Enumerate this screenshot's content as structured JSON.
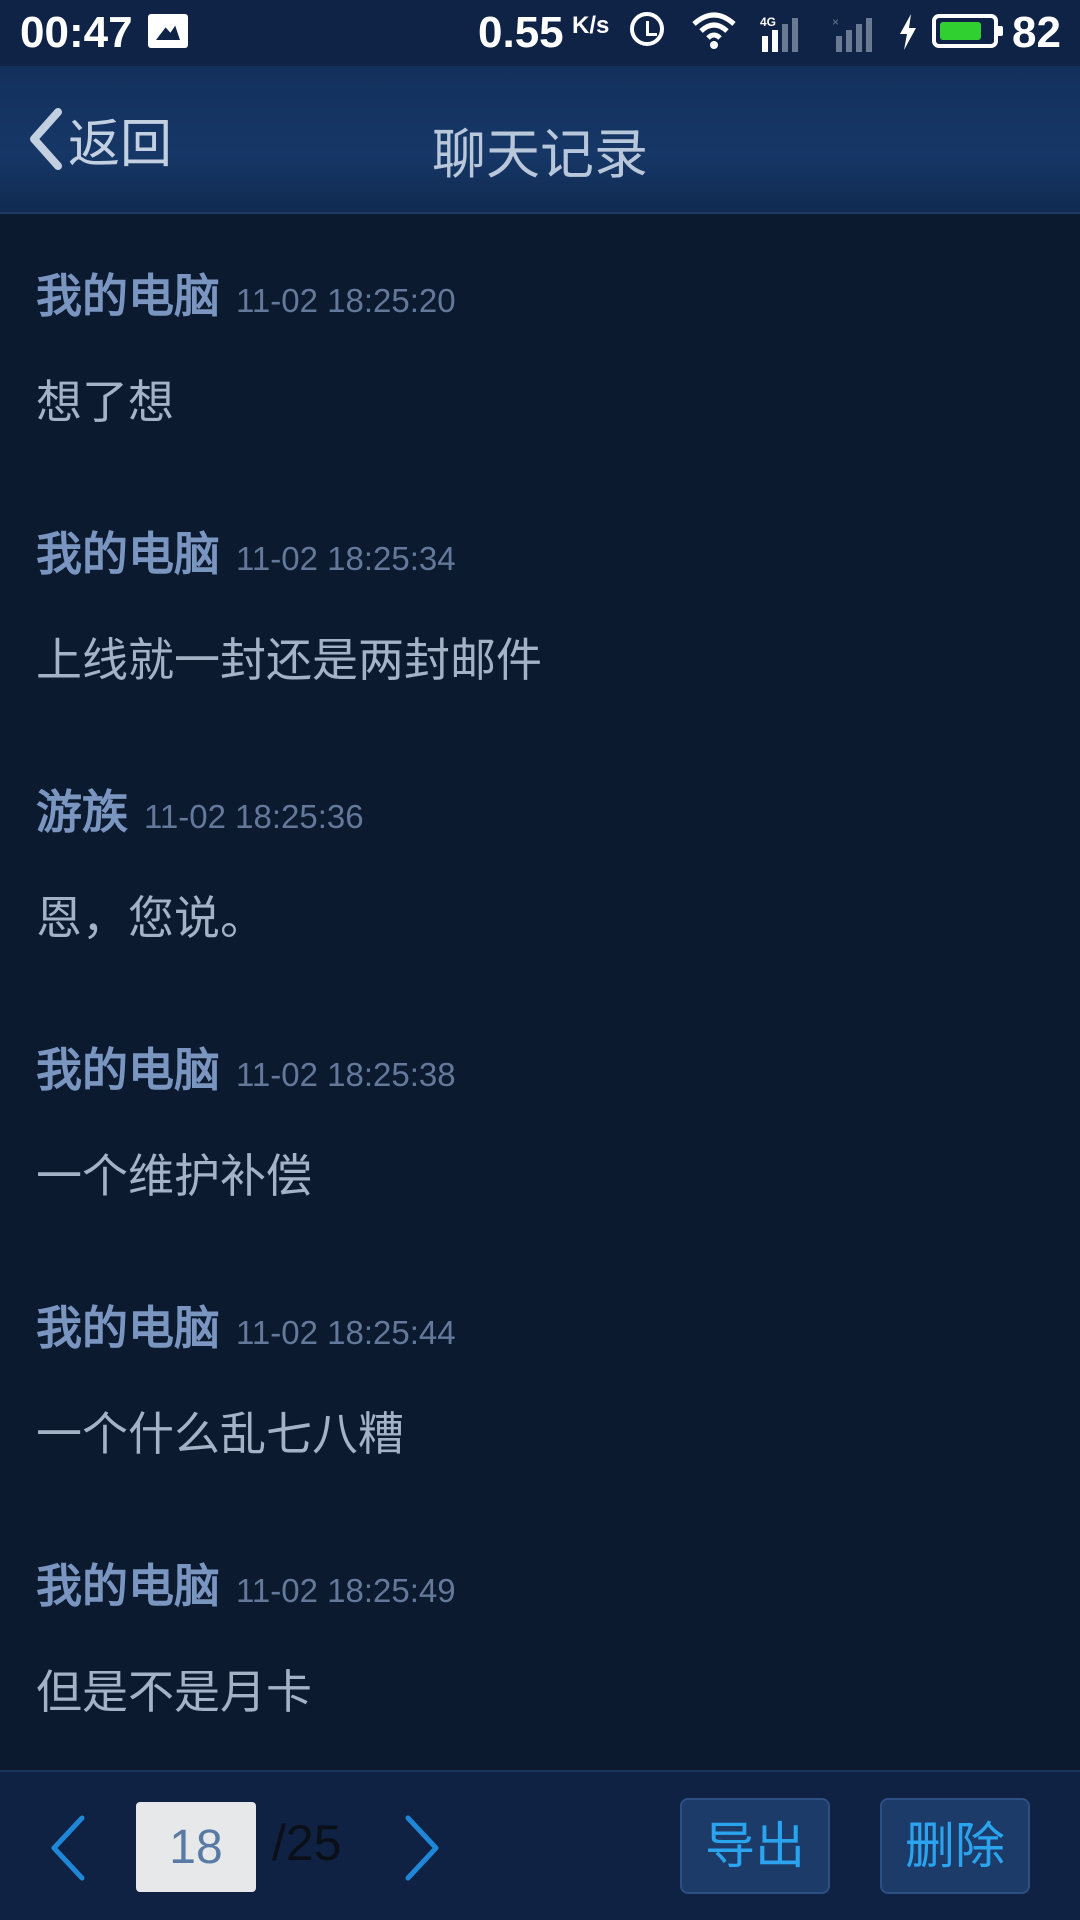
{
  "status_bar": {
    "time": "00:47",
    "speed": "0.55",
    "speed_unit": "K/s",
    "network": "4G",
    "battery_level": "82",
    "battery_fraction": 0.82
  },
  "header": {
    "back_label": "返回",
    "title": "聊天记录"
  },
  "messages": [
    {
      "sender": "我的电脑",
      "time": "11-02 18:25:20",
      "text": "想了想"
    },
    {
      "sender": "我的电脑",
      "time": "11-02 18:25:34",
      "text": "上线就一封还是两封邮件"
    },
    {
      "sender": "游族",
      "time": "11-02 18:25:36",
      "text": "恩，您说。"
    },
    {
      "sender": "我的电脑",
      "time": "11-02 18:25:38",
      "text": "一个维护补偿"
    },
    {
      "sender": "我的电脑",
      "time": "11-02 18:25:44",
      "text": "一个什么乱七八糟"
    },
    {
      "sender": "我的电脑",
      "time": "11-02 18:25:49",
      "text": "但是不是月卡"
    }
  ],
  "pagination": {
    "current_page": "18",
    "total": "/25"
  },
  "actions": {
    "export_label": "导出",
    "delete_label": "删除"
  },
  "colors": {
    "background": "#0c1a30",
    "header": "#163767",
    "accent": "#2aa4ef",
    "sender": "#7a95bf"
  }
}
